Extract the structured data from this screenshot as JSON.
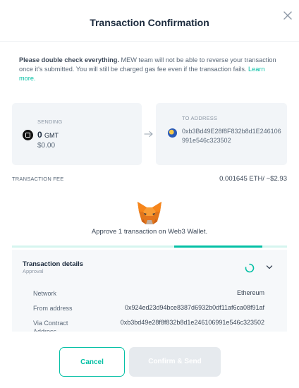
{
  "dialog": {
    "title": "Transaction Confirmation",
    "close_icon": "close-icon"
  },
  "notice": {
    "bold": "Please double check everything.",
    "text": " MEW team will not be able to reverse your transaction once it's submitted. You will still be charged gas fee even if the transaction fails. ",
    "link": "Learn more."
  },
  "sending": {
    "label": "SENDING",
    "amount": "0",
    "unit": "GMT",
    "usd": "$0.00",
    "icon": "token-icon"
  },
  "to_address": {
    "label": "TO ADDRESS",
    "address": "0xb3Bd49E28f8F832b8d1E246106991e546c323502",
    "icon": "address-identicon"
  },
  "fee": {
    "label": "TRANSACTION FEE",
    "value": "0.001645 ETH/ ~$2.93"
  },
  "wallet": {
    "approve_text": "Approve 1 transaction on Web3 Wallet.",
    "icon": "metamask-fox-icon",
    "progress": 0.72
  },
  "details": {
    "title": "Transaction details",
    "subtitle": "Approval",
    "rows": [
      {
        "label": "Network",
        "value": "Ethereum"
      },
      {
        "label": "From address",
        "value": "0x924ed23d94bce8387d6932b0df11af6ca08f91af"
      },
      {
        "label": "Via Contract Address",
        "value": "0xb3bd49e28f8f832b8d1e246106991e546c323502"
      }
    ]
  },
  "buttons": {
    "cancel": "Cancel",
    "confirm": "Confirm & Send"
  },
  "colors": {
    "accent": "#05c0a5",
    "disabled": "#e6eaee"
  }
}
